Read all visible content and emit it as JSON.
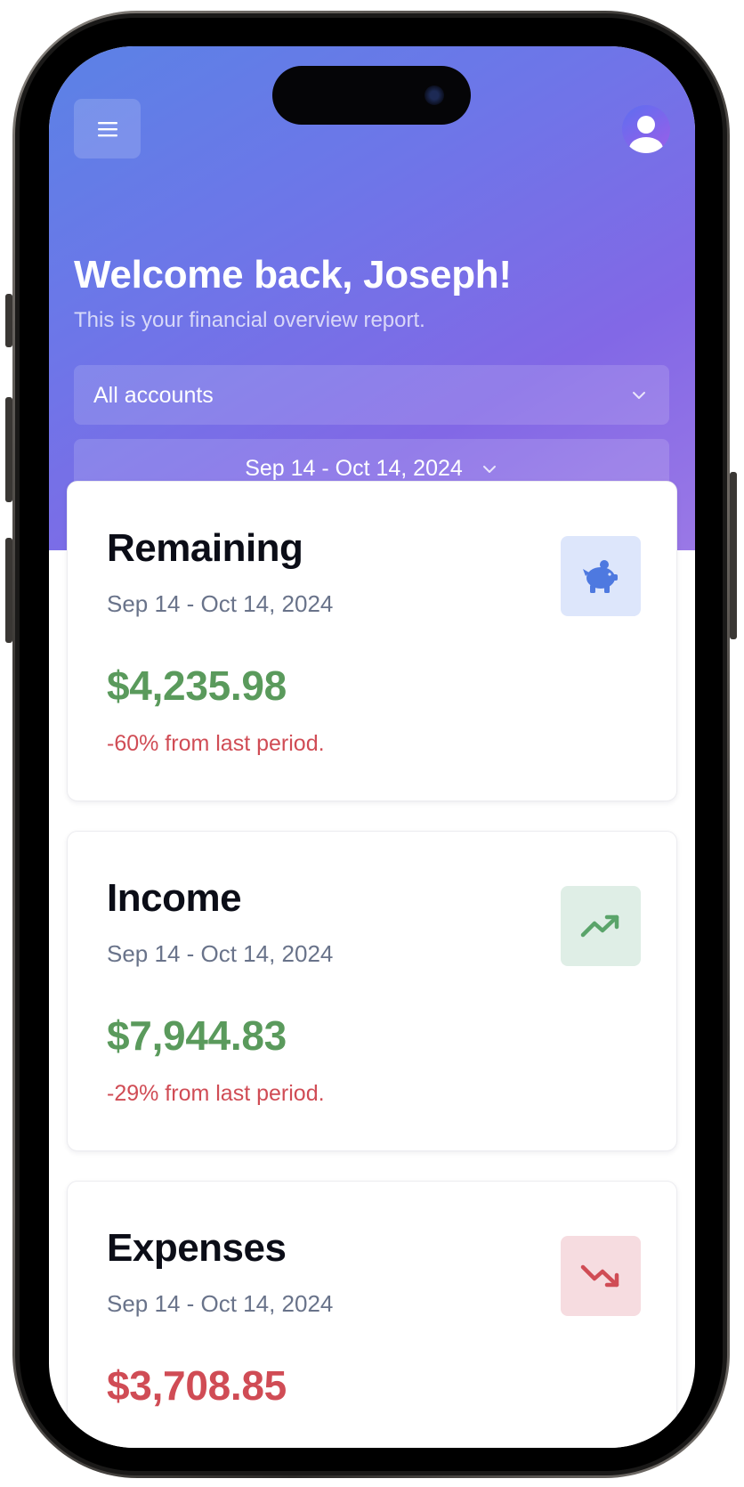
{
  "header": {
    "menu_icon": "hamburger-menu-icon",
    "avatar_icon": "user-avatar-icon",
    "title": "Welcome back, Joseph!",
    "subtitle": "This is your financial overview report."
  },
  "filters": {
    "accounts": "All accounts",
    "date_range": "Sep 14 - Oct 14, 2024"
  },
  "cards": [
    {
      "title": "Remaining",
      "date": "Sep 14 - Oct 14, 2024",
      "amount": "$4,235.98",
      "change": "-60% from last period.",
      "icon": "piggy-bank-icon",
      "icon_bg": "#dde6fb",
      "icon_color": "#4e79e0"
    },
    {
      "title": "Income",
      "date": "Sep 14 - Oct 14, 2024",
      "amount": "$7,944.83",
      "change": "-29% from last period.",
      "icon": "trending-up-icon",
      "icon_bg": "#dfeee6",
      "icon_color": "#5aa46a"
    },
    {
      "title": "Expenses",
      "date": "Sep 14 - Oct 14, 2024",
      "amount": "$3,708.85",
      "change": "",
      "icon": "trending-down-icon",
      "icon_bg": "#f6dce0",
      "icon_color": "#d04c55"
    }
  ],
  "colors": {
    "hero_start": "#5b82e6",
    "hero_end": "#9a78e6",
    "amount_positive": "#5a9a5c",
    "amount_negative": "#d04c55",
    "change_negative": "#d04c55"
  }
}
